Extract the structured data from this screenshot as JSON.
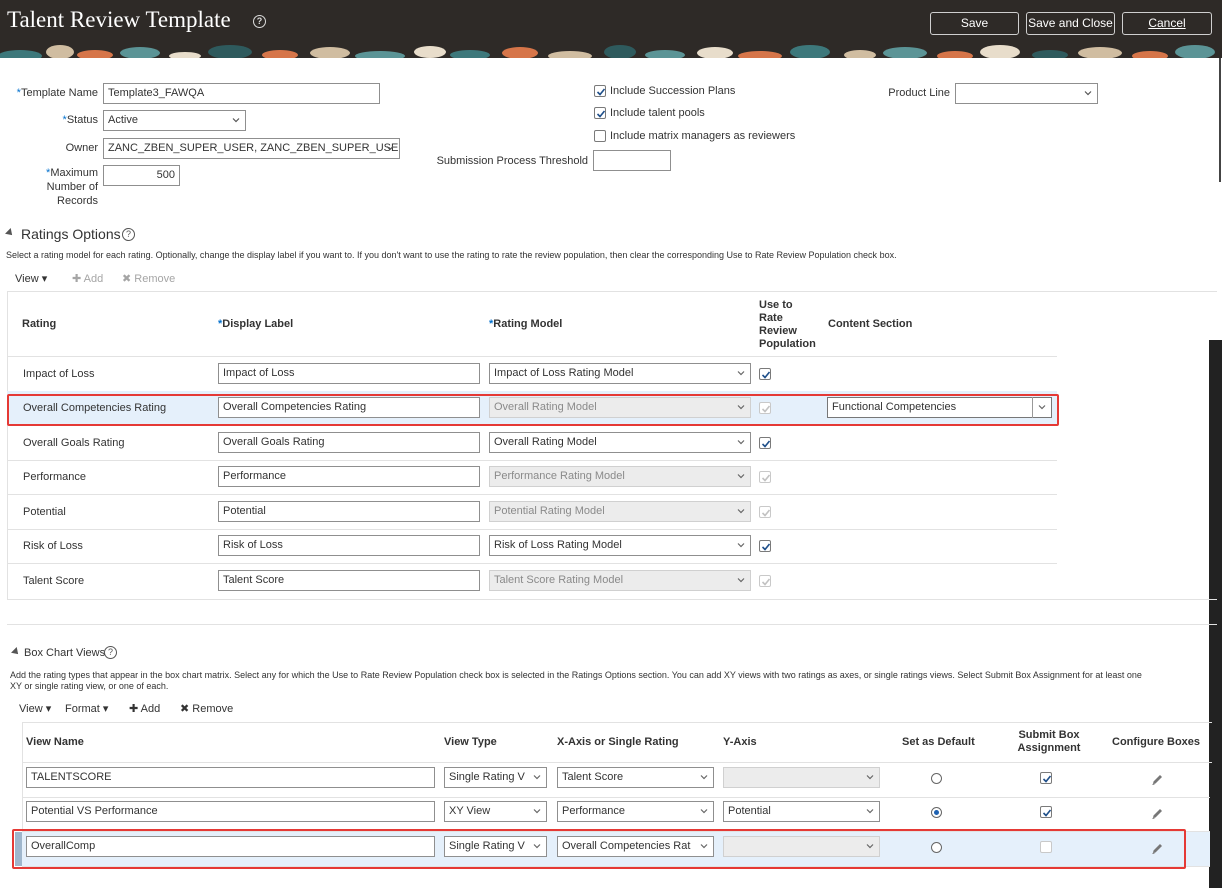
{
  "header": {
    "title": "Talent Review Template",
    "save": "Save",
    "save_close": "Save and Close",
    "cancel": "Cancel"
  },
  "form": {
    "template_name_label": "Template Name",
    "template_name_value": "Template3_FAWQA",
    "status_label": "Status",
    "status_value": "Active",
    "owner_label": "Owner",
    "owner_value": "ZANC_ZBEN_SUPER_USER, ZANC_ZBEN_SUPER_USER",
    "max_records_label_1": "Maximum",
    "max_records_label_2": "Number of",
    "max_records_label_3": "Records",
    "max_records_value": "500",
    "include_succession": "Include Succession Plans",
    "include_pools": "Include talent pools",
    "include_matrix": "Include matrix managers as reviewers",
    "submission_threshold_label": "Submission Process Threshold",
    "submission_threshold_value": "",
    "product_line_label": "Product Line",
    "product_line_value": "",
    "required_marker": "*"
  },
  "ratings": {
    "title": "Ratings Options",
    "description": "Select a rating model for each rating. Optionally, change the display label if you want to. If you don't want to use the rating to rate the review population, then clear the corresponding Use to Rate Review Population check box.",
    "toolbar": {
      "view": "View",
      "add": "Add",
      "remove": "Remove"
    },
    "columns": {
      "rating": "Rating",
      "display_label": "Display Label",
      "rating_model": "Rating Model",
      "use_1": "Use to",
      "use_2": "Rate",
      "use_3": "Review",
      "use_4": "Population",
      "content_section": "Content Section"
    },
    "rows": [
      {
        "rating": "Impact of Loss",
        "label": "Impact of Loss",
        "model": "Impact of Loss Rating Model",
        "model_ro": false,
        "use": true,
        "use_ro": false,
        "content": ""
      },
      {
        "rating": "Overall Competencies Rating",
        "label": "Overall Competencies Rating",
        "model": "Overall Rating Model",
        "model_ro": true,
        "use": true,
        "use_ro": true,
        "content": "Functional Competencies"
      },
      {
        "rating": "Overall Goals Rating",
        "label": "Overall Goals Rating",
        "model": "Overall Rating Model",
        "model_ro": false,
        "use": true,
        "use_ro": false,
        "content": ""
      },
      {
        "rating": "Performance",
        "label": "Performance",
        "model": "Performance Rating Model",
        "model_ro": true,
        "use": true,
        "use_ro": true,
        "content": ""
      },
      {
        "rating": "Potential",
        "label": "Potential",
        "model": "Potential Rating Model",
        "model_ro": true,
        "use": true,
        "use_ro": true,
        "content": ""
      },
      {
        "rating": "Risk of Loss",
        "label": "Risk of Loss",
        "model": "Risk of Loss Rating Model",
        "model_ro": false,
        "use": true,
        "use_ro": false,
        "content": ""
      },
      {
        "rating": "Talent Score",
        "label": "Talent Score",
        "model": "Talent Score Rating Model",
        "model_ro": true,
        "use": true,
        "use_ro": true,
        "content": ""
      }
    ]
  },
  "box_chart": {
    "title": "Box Chart Views",
    "description_1": "Add the rating types that appear in the box chart matrix. Select any for which the Use to Rate Review Population check box is selected in the Ratings Options section. You can add XY views with two ratings as axes, or single ratings views. Select Submit Box Assignment for at least one",
    "description_2": "XY or single rating view, or one of each.",
    "toolbar": {
      "view": "View",
      "format": "Format",
      "add": "Add",
      "remove": "Remove"
    },
    "columns": {
      "view_name": "View Name",
      "view_type": "View Type",
      "x_axis": "X-Axis or Single Rating",
      "y_axis": "Y-Axis",
      "default": "Set as Default",
      "submit_1": "Submit Box",
      "submit_2": "Assignment",
      "configure": "Configure Boxes"
    },
    "rows": [
      {
        "name": "TALENTSCORE",
        "type": "Single Rating V",
        "x": "Talent Score",
        "y": "",
        "y_ro": true,
        "default": false,
        "submit": true,
        "submit_ro": false
      },
      {
        "name": "Potential VS Performance",
        "type": "XY View",
        "x": "Performance",
        "y": "Potential",
        "y_ro": false,
        "default": true,
        "submit": true,
        "submit_ro": false
      },
      {
        "name": "OverallComp",
        "type": "Single Rating V",
        "x": "Overall Competencies Rat",
        "y": "",
        "y_ro": true,
        "default": false,
        "submit": false,
        "submit_ro": true
      }
    ]
  },
  "colors": {
    "header_bg": "#2e2a27",
    "highlight_border": "#e53935",
    "selected_row_bg": "#e5f0fb",
    "required": "#0572ce"
  }
}
